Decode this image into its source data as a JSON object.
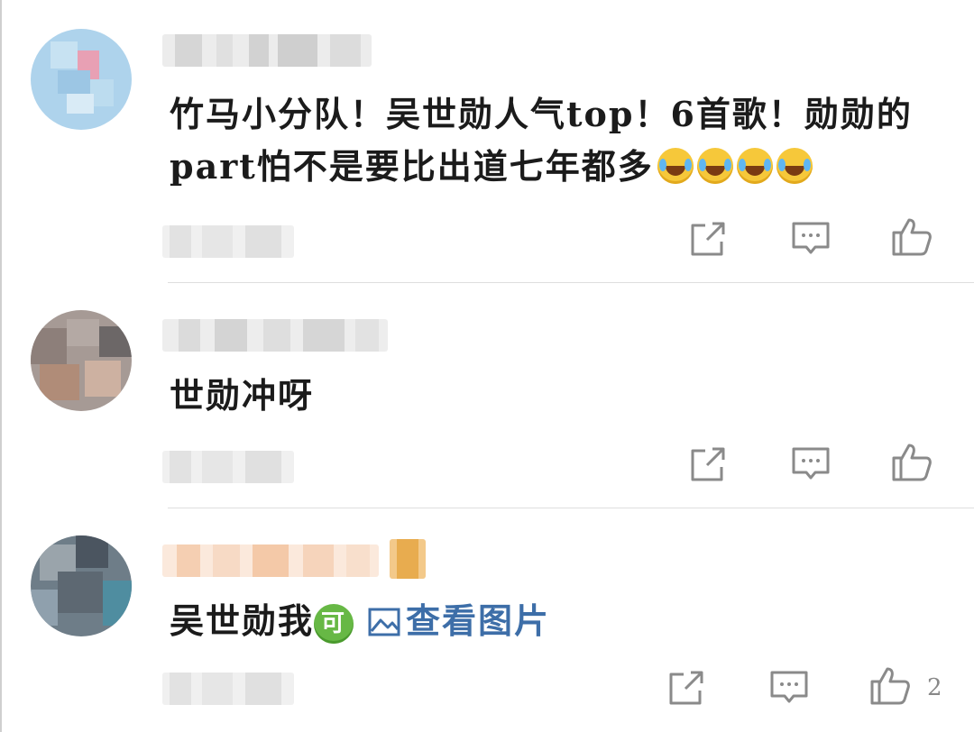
{
  "comments": [
    {
      "text": "竹马小分队！吴世勋人气top！6首歌！勋勋的part怕不是要比出道七年都多",
      "emojis": [
        "laughing-crying-emoji",
        "laughing-crying-emoji",
        "laughing-crying-emoji",
        "laughing-crying-emoji"
      ],
      "likes": ""
    },
    {
      "text": "世勋冲呀",
      "likes": ""
    },
    {
      "text": "吴世勋我",
      "badge": "可",
      "image_link": "查看图片",
      "likes": "2"
    }
  ],
  "icons": {
    "share": "share-icon",
    "reply": "comment-icon",
    "like": "thumbs-up-icon",
    "picture": "picture-icon"
  },
  "colors": {
    "link": "#3d6ea8",
    "badge": "#67b845",
    "icon": "#8a8a8a"
  }
}
